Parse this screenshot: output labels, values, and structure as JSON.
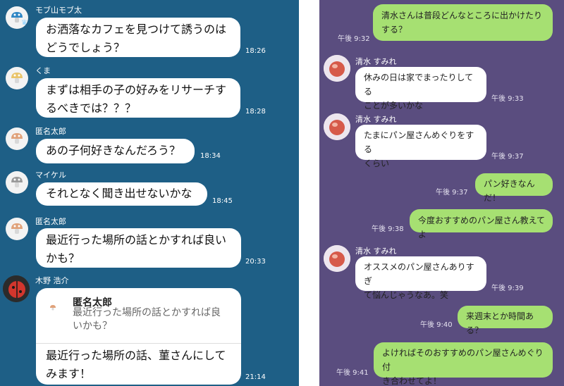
{
  "left_chat": {
    "messages": [
      {
        "sender": "モブ山モブ太",
        "text": "お洒落なカフェを見つけて誘うのは\nどうでしょう？",
        "time": "18:26",
        "avatar_icon": "mushroom-icon"
      },
      {
        "sender": "くま",
        "text": "まずは相手の子の好みをリサーチす\nるべきでは？？？",
        "time": "18:28",
        "avatar_icon": "mushroom-icon"
      },
      {
        "sender": "匿名太郎",
        "text": "あの子何好きなんだろう？",
        "time": "18:34",
        "avatar_icon": "mushroom-icon"
      },
      {
        "sender": "マイケル",
        "text": "それとなく聞き出せないかな",
        "time": "18:45",
        "avatar_icon": "mushroom-icon"
      },
      {
        "sender": "匿名太郎",
        "text": "最近行った場所の話とかすれば良い\nかも？",
        "time": "20:33",
        "avatar_icon": "mushroom-icon"
      },
      {
        "sender": "木野 浩介",
        "reply_sender": "匿名太郎",
        "reply_text": "最近行った場所の話とかすれば良\nいかも？",
        "text": "最近行った場所の話、菫さんにして\nみます！",
        "time": "21:14",
        "avatar_icon": "ladybug-icon"
      }
    ]
  },
  "right_chat": {
    "messages": [
      {
        "side": "right",
        "text": "清水さんは普段どんなところに出かけたりする？",
        "time": "午後 9:32"
      },
      {
        "side": "left",
        "sender": "清水 すみれ",
        "text": "休みの日は家でまったりしてる\nことが多いかな",
        "time": "午後 9:33"
      },
      {
        "side": "left",
        "sender": "清水 すみれ",
        "text": "たまにパン屋さんめぐりをする\nくらい",
        "time": "午後 9:37"
      },
      {
        "side": "right",
        "text": "パン好きなんだ！",
        "time": "午後 9:37"
      },
      {
        "side": "right",
        "text": "今度おすすめのパン屋さん教えてよ",
        "time": "午後 9:38"
      },
      {
        "side": "left",
        "sender": "清水 すみれ",
        "text": "オススメのパン屋さんありすぎ\nて悩んじゃうなあ。笑",
        "time": "午後 9:39"
      },
      {
        "side": "right",
        "text": "来週末とか時間ある？",
        "time": "午後 9:40"
      },
      {
        "side": "right",
        "text": "よければそのおすすめのパン屋さんめぐり付\nき合わせてよ！",
        "time": "午後 9:41"
      }
    ]
  },
  "colors": {
    "left_bg": "#1e5f86",
    "right_bg": "#5a4d7f",
    "my_bubble": "#a6e072",
    "their_bubble": "#ffffff"
  }
}
